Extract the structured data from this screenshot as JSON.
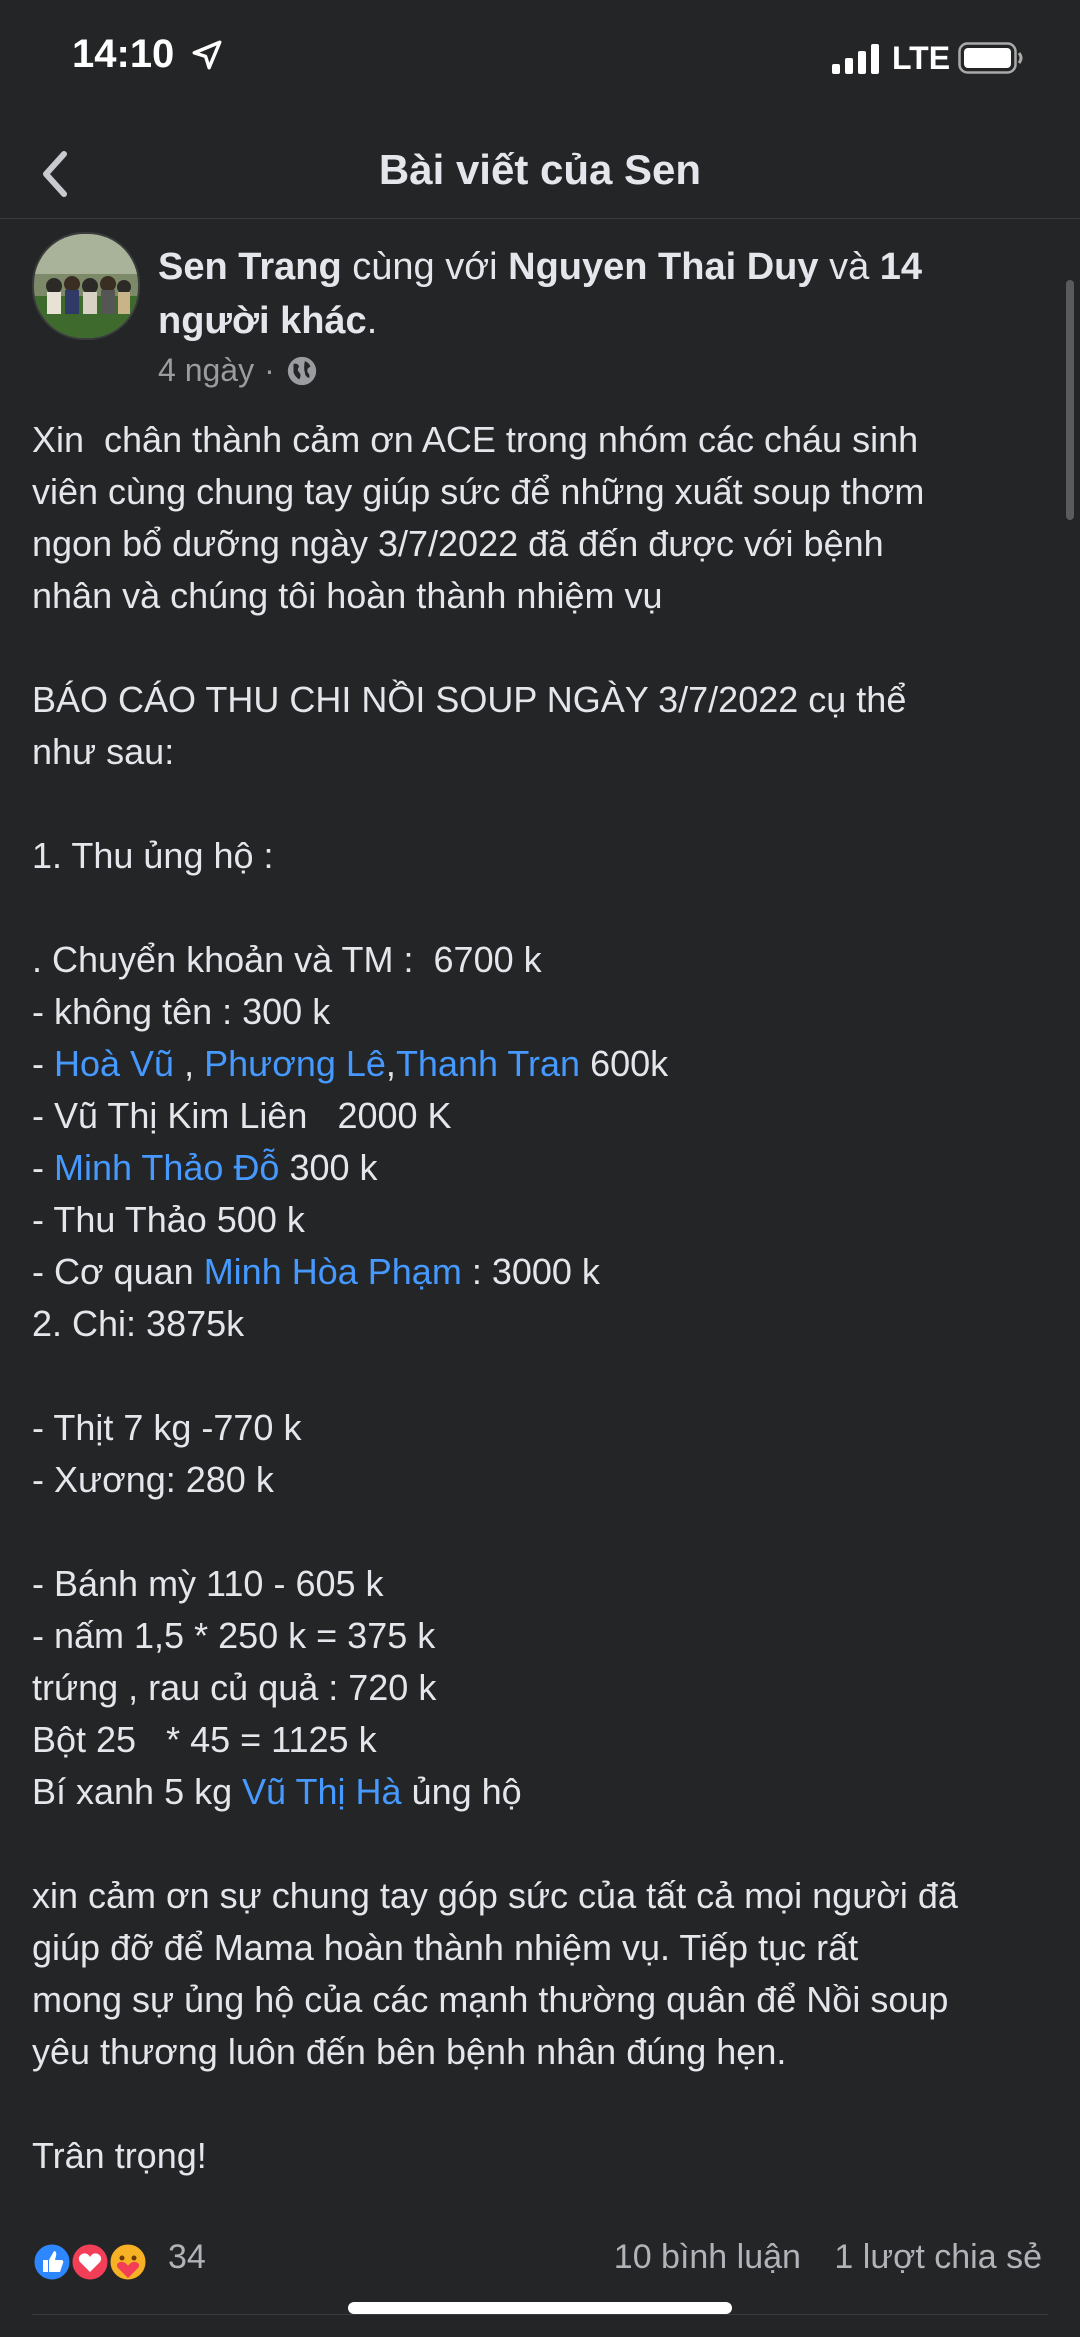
{
  "status": {
    "time": "14:10",
    "network": "LTE"
  },
  "nav": {
    "title": "Bài viết của Sen"
  },
  "post": {
    "author": "Sen Trang",
    "with_text": " cùng với ",
    "tagged": "Nguyen Thai Duy",
    "and_text": " và ",
    "others": "14 người khác",
    "period": ".",
    "time": "4 ngày",
    "dot": "·",
    "privacy_icon": "globe-icon",
    "lines": [
      "Xin  chân thành cảm ơn ACE trong nhóm các cháu sinh",
      "viên cùng chung tay giúp sức để những xuất soup thơm",
      "ngon bổ dưỡng ngày 3/7/2022 đã đến được với bệnh",
      "nhân và chúng tôi hoàn thành nhiệm vụ",
      "",
      "BÁO CÁO THU CHI NỒI SOUP NGÀY 3/7/2022 cụ thể",
      "như sau:",
      "",
      "1. Thu ủng hộ :",
      "",
      ". Chuyển khoản và TM :  6700 k",
      "- không tên : 300 k",
      "HOA_LINE",
      "- Vũ Thị Kim Liên   2000 K",
      "MINH_LINE",
      "- Thu Thảo 500 k",
      "COQUAN_LINE",
      "2. Chi: 3875k",
      "",
      "- Thịt 7 kg -770 k",
      "- Xương: 280 k",
      "",
      "- Bánh mỳ 110 - 605 k",
      "- nấm 1,5 * 250 k = 375 k",
      "trứng , rau củ quả : 720 k",
      "Bột 25   * 45 = 1125 k",
      "BI_LINE",
      "",
      "xin cảm ơn sự chung tay góp sức của tất cả mọi người đã",
      "giúp đỡ để Mama hoàn thành nhiệm vụ. Tiếp tục rất",
      "mong sự ủng hộ của các mạnh thường quân để Nồi soup",
      "yêu thương luôn đến bên bệnh nhân đúng hẹn.",
      "",
      "Trân trọng!"
    ],
    "mentions": {
      "hoa": {
        "prefix": "- ",
        "m1": "Hoà Vũ",
        "sep1": " , ",
        "m2": "Phương Lê",
        "sep2": ",",
        "m3": "Thanh Tran",
        "suffix": " 600k"
      },
      "minh": {
        "prefix": "- ",
        "m1": "Minh Thảo Đỗ",
        "suffix": " 300 k"
      },
      "coquan": {
        "prefix": "- Cơ quan ",
        "m1": "Minh Hòa Phạm",
        "suffix": " : 3000 k"
      },
      "bi": {
        "prefix": "Bí xanh 5 kg ",
        "m1": "Vũ Thị Hà",
        "suffix": " ủng hộ"
      }
    },
    "reactions": {
      "count": "34",
      "types": [
        "like-icon",
        "love-icon",
        "care-icon"
      ]
    },
    "comments": "10 bình luận",
    "shares": "1 lượt chia sẻ"
  }
}
